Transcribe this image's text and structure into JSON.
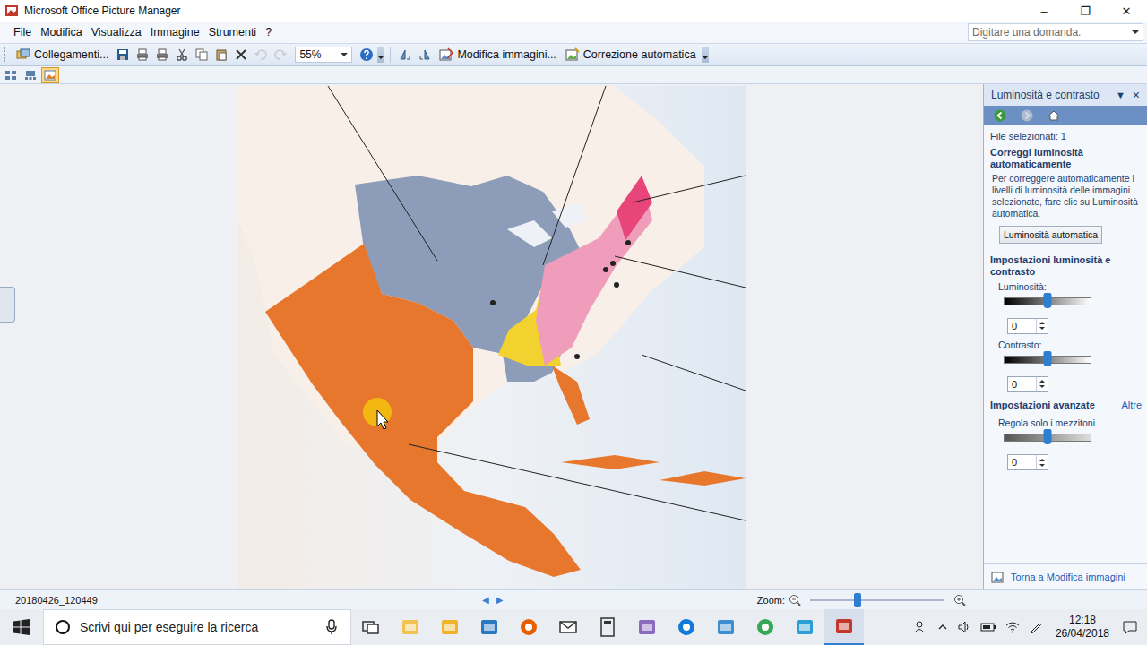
{
  "window": {
    "title": "Microsoft Office Picture Manager",
    "controls": [
      "–",
      "❐",
      "✕"
    ]
  },
  "menu": [
    {
      "label": "File"
    },
    {
      "label": "Modifica"
    },
    {
      "label": "Visualizza"
    },
    {
      "label": "Immagine"
    },
    {
      "label": "Strumenti"
    },
    {
      "label": "?"
    }
  ],
  "help_search": {
    "placeholder": "Digitare una domanda."
  },
  "toolbar": {
    "links": "Collegamenti...",
    "zoom": "55%",
    "edit": "Modifica immagini...",
    "autocorrect": "Correzione automatica",
    "tools_left": [
      {
        "kind": "save",
        "disabled": false
      },
      {
        "kind": "print",
        "disabled": false
      },
      {
        "kind": "print-alt",
        "disabled": false
      },
      {
        "kind": "cut",
        "disabled": false
      },
      {
        "kind": "copy",
        "disabled": false
      },
      {
        "kind": "paste",
        "disabled": false
      },
      {
        "kind": "delete",
        "disabled": false
      },
      {
        "kind": "undo",
        "disabled": true
      },
      {
        "kind": "redo",
        "disabled": true
      }
    ],
    "tools_right": [
      {
        "kind": "rotate-left",
        "disabled": false
      },
      {
        "kind": "rotate-right",
        "disabled": false
      }
    ]
  },
  "view_modes": [
    {
      "kind": "thumbnails",
      "selected": false
    },
    {
      "kind": "filmstrip",
      "selected": false
    },
    {
      "kind": "single",
      "selected": true
    }
  ],
  "panel": {
    "title": "Luminosità e contrasto",
    "menu_glyph": "▼",
    "close_glyph": "×",
    "nav": [
      {
        "kind": "back",
        "disabled": false
      },
      {
        "kind": "forward",
        "disabled": true
      },
      {
        "kind": "home",
        "disabled": false
      }
    ],
    "file_count": "File selezionati: 1",
    "auto_heading": "Correggi luminosità automaticamente",
    "auto_text": "Per correggere automaticamente i livelli di luminosità delle immagini selezionate, fare clic su Luminosità automatica.",
    "auto_button": "Luminosità automatica",
    "settings_heading": "Impostazioni luminosità e contrasto",
    "sliders": [
      {
        "label": "Luminosità:",
        "value": "0",
        "level": 0.5
      },
      {
        "label": "Contrasto:",
        "value": "0",
        "level": 0.5
      }
    ],
    "advanced_heading": "Impostazioni avanzate",
    "advanced_link": "Altre",
    "midtones": {
      "label": "Regola solo i mezzitoni",
      "value": "0",
      "level": 0.5
    },
    "back_link": "Torna a Modifica immagini"
  },
  "status_bar": {
    "filename": "20180426_120449",
    "prev": "◀",
    "next": "▶",
    "zoom_label": "Zoom:",
    "zoom_level": 0.35
  },
  "taskbar": {
    "search_placeholder": "Scrivi qui per eseguire la ricerca",
    "time": "12:18",
    "date": "26/04/2018",
    "apps": [
      {
        "kind": "task-view",
        "color": "#333333",
        "active": false
      },
      {
        "kind": "explorer",
        "color": "#f2c14e",
        "active": false
      },
      {
        "kind": "folder",
        "color": "#f0b429",
        "active": false
      },
      {
        "kind": "store",
        "color": "#2b78c2",
        "active": false
      },
      {
        "kind": "firefox",
        "color": "#e66000",
        "active": false
      },
      {
        "kind": "mail",
        "color": "#333333",
        "active": false
      },
      {
        "kind": "calculator",
        "color": "#333333",
        "active": false
      },
      {
        "kind": "paint",
        "color": "#8a6bbd",
        "active": false
      },
      {
        "kind": "edge",
        "color": "#0f7ad8",
        "active": false
      },
      {
        "kind": "remote",
        "color": "#3b8ed0",
        "active": false
      },
      {
        "kind": "chrome",
        "color": "#34a853",
        "active": false
      },
      {
        "kind": "editor",
        "color": "#2a9fd6",
        "active": false
      },
      {
        "kind": "picture-manager",
        "color": "#c0392b",
        "active": true
      }
    ]
  }
}
